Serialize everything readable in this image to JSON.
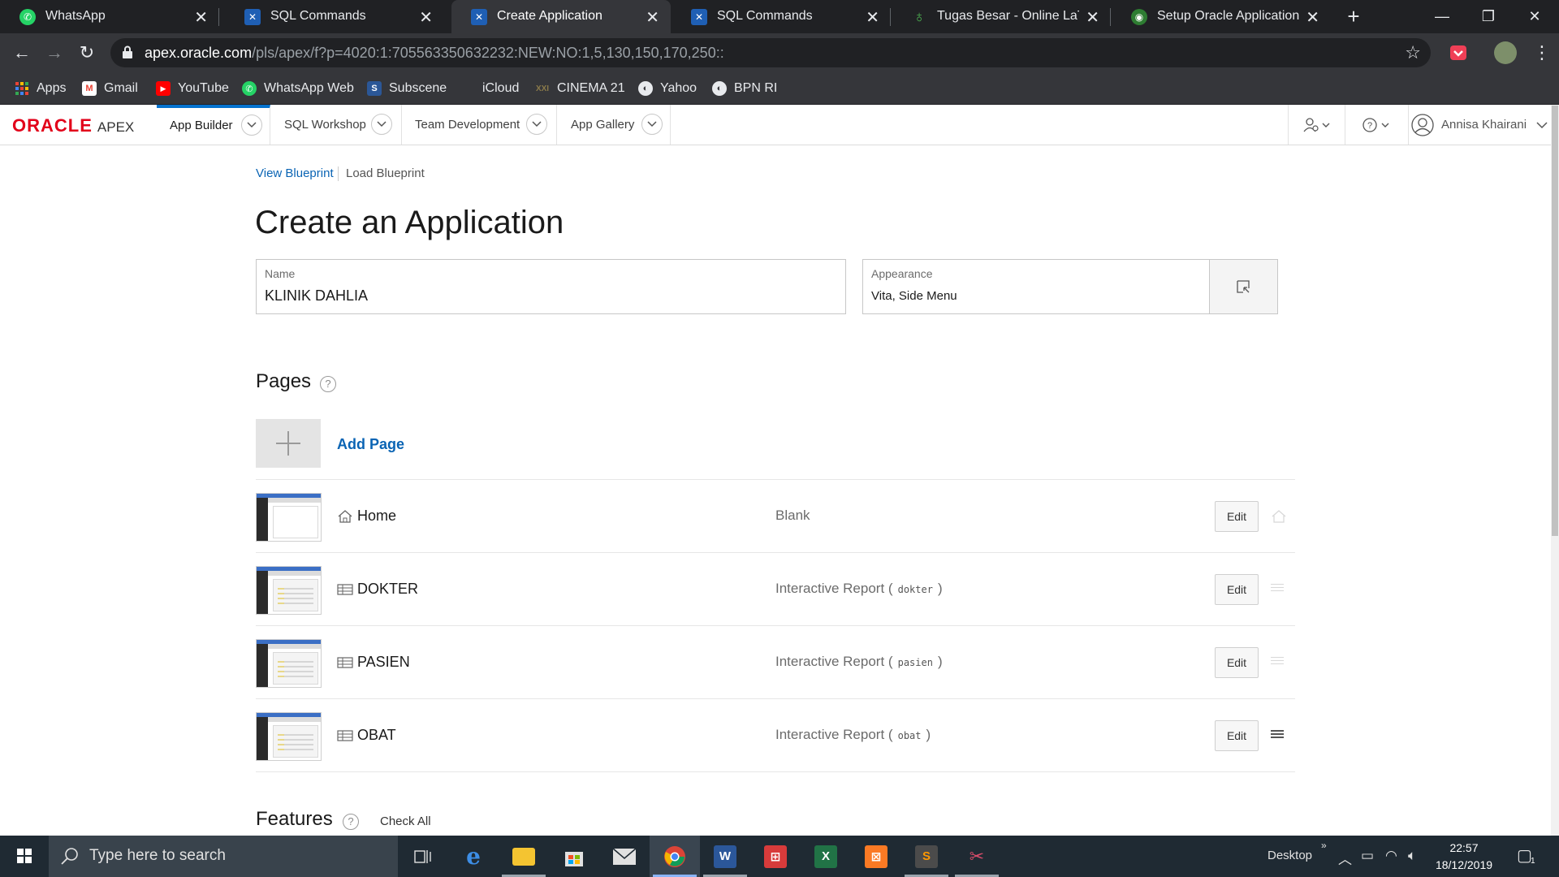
{
  "browser": {
    "tabs": [
      {
        "title": "WhatsApp",
        "icon": "whatsapp-icon",
        "active": false
      },
      {
        "title": "SQL Commands",
        "icon": "apex-icon",
        "active": false
      },
      {
        "title": "Create Application",
        "icon": "apex-icon",
        "active": true
      },
      {
        "title": "SQL Commands",
        "icon": "apex-icon",
        "active": false
      },
      {
        "title": "Tugas Besar - Online LaTeX E",
        "icon": "overleaf-icon",
        "active": false
      },
      {
        "title": "Setup Oracle Application Exp",
        "icon": "chrome-web-icon",
        "active": false
      }
    ],
    "url_host": "apex.oracle.com",
    "url_path": "/pls/apex/f?p=4020:1:705563350632232:NEW:NO:1,5,130,150,170,250::",
    "bookmarks": [
      {
        "label": "Apps",
        "icon": "apps-grid-icon",
        "color": "#ea4335"
      },
      {
        "label": "Gmail",
        "icon": "gmail-icon",
        "color": "#ea4335"
      },
      {
        "label": "YouTube",
        "icon": "youtube-icon",
        "color": "#ff0000"
      },
      {
        "label": "WhatsApp Web",
        "icon": "whatsapp-icon",
        "color": "#25d366"
      },
      {
        "label": "Subscene",
        "icon": "subscene-icon",
        "color": "#2b5797"
      },
      {
        "label": "iCloud",
        "icon": "apple-icon",
        "color": "#bbbbbb"
      },
      {
        "label": "CINEMA 21",
        "icon": "cinema21-icon",
        "color": "#8a7a4a"
      },
      {
        "label": "Yahoo",
        "icon": "globe-icon",
        "color": "#e8eaed"
      },
      {
        "label": "BPN RI",
        "icon": "globe-icon",
        "color": "#e8eaed"
      }
    ]
  },
  "apex": {
    "logo_oracle": "ORACLE",
    "logo_apex": "APEX",
    "menu": [
      "App Builder",
      "SQL Workshop",
      "Team Development",
      "App Gallery"
    ],
    "user_name": "Annisa Khairani"
  },
  "main": {
    "blueprint_view": "View Blueprint",
    "blueprint_load": "Load Blueprint",
    "title": "Create an Application",
    "name_label": "Name",
    "name_value": "KLINIK DAHLIA",
    "appearance_label": "Appearance",
    "appearance_value": "Vita, Side Menu",
    "pages_heading": "Pages",
    "add_page": "Add Page",
    "pages": [
      {
        "name": "Home",
        "icon": "home-icon",
        "type": "Blank",
        "table": "",
        "edit": "Edit"
      },
      {
        "name": "DOKTER",
        "icon": "report-icon",
        "type": "Interactive Report",
        "table": "dokter",
        "edit": "Edit"
      },
      {
        "name": "PASIEN",
        "icon": "report-icon",
        "type": "Interactive Report",
        "table": "pasien",
        "edit": "Edit"
      },
      {
        "name": "OBAT",
        "icon": "report-icon",
        "type": "Interactive Report",
        "table": "obat",
        "edit": "Edit"
      }
    ],
    "paren_open": "(",
    "paren_close": ")",
    "features_heading": "Features",
    "check_all": "Check All"
  },
  "taskbar": {
    "search_placeholder": "Type here to search",
    "desktop_label": "Desktop",
    "time": "22:57",
    "date": "18/12/2019",
    "notifications": "1"
  },
  "colors": {
    "oracle_red": "#e2001a",
    "apex_blue": "#0572ce",
    "link_blue": "#0a64b4"
  }
}
